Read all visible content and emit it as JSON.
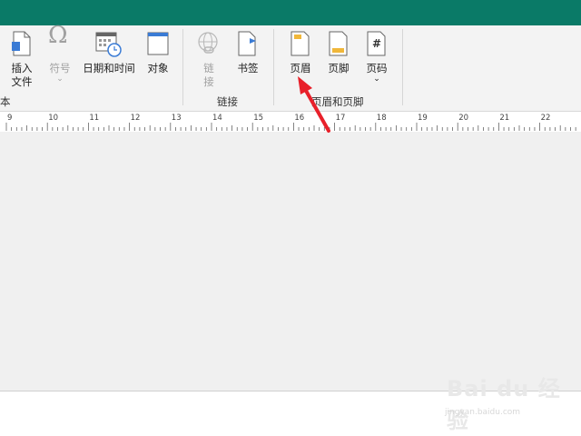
{
  "ribbon": {
    "buttons": {
      "insert_file": {
        "label1": "插入",
        "label2": "文件"
      },
      "symbol": {
        "label": "符号",
        "chevron": "⌄"
      },
      "datetime": {
        "label": "日期和时间"
      },
      "object": {
        "label": "对象"
      },
      "link": {
        "label1": "链",
        "label2": "接"
      },
      "bookmark": {
        "label": "书签"
      },
      "header": {
        "label": "页眉"
      },
      "footer": {
        "label": "页脚"
      },
      "page_number": {
        "label": "页码",
        "chevron": "⌄",
        "icon_glyph": "#"
      }
    },
    "groups": {
      "text_partial": "本",
      "links": "链接",
      "header_footer": "页眉和页脚"
    }
  },
  "ruler": {
    "labels": [
      "9",
      "10",
      "11",
      "12",
      "13",
      "14",
      "15",
      "16",
      "17",
      "18",
      "19",
      "20",
      "21",
      "22"
    ]
  },
  "watermark": {
    "brand": "Bai du 经验",
    "url": "jingyan.baidu.com"
  },
  "colors": {
    "title_bar": "#0a7a67",
    "ribbon_bg": "#f3f3f3",
    "canvas_bg": "#f0f0f0",
    "arrow": "#e8202a"
  }
}
